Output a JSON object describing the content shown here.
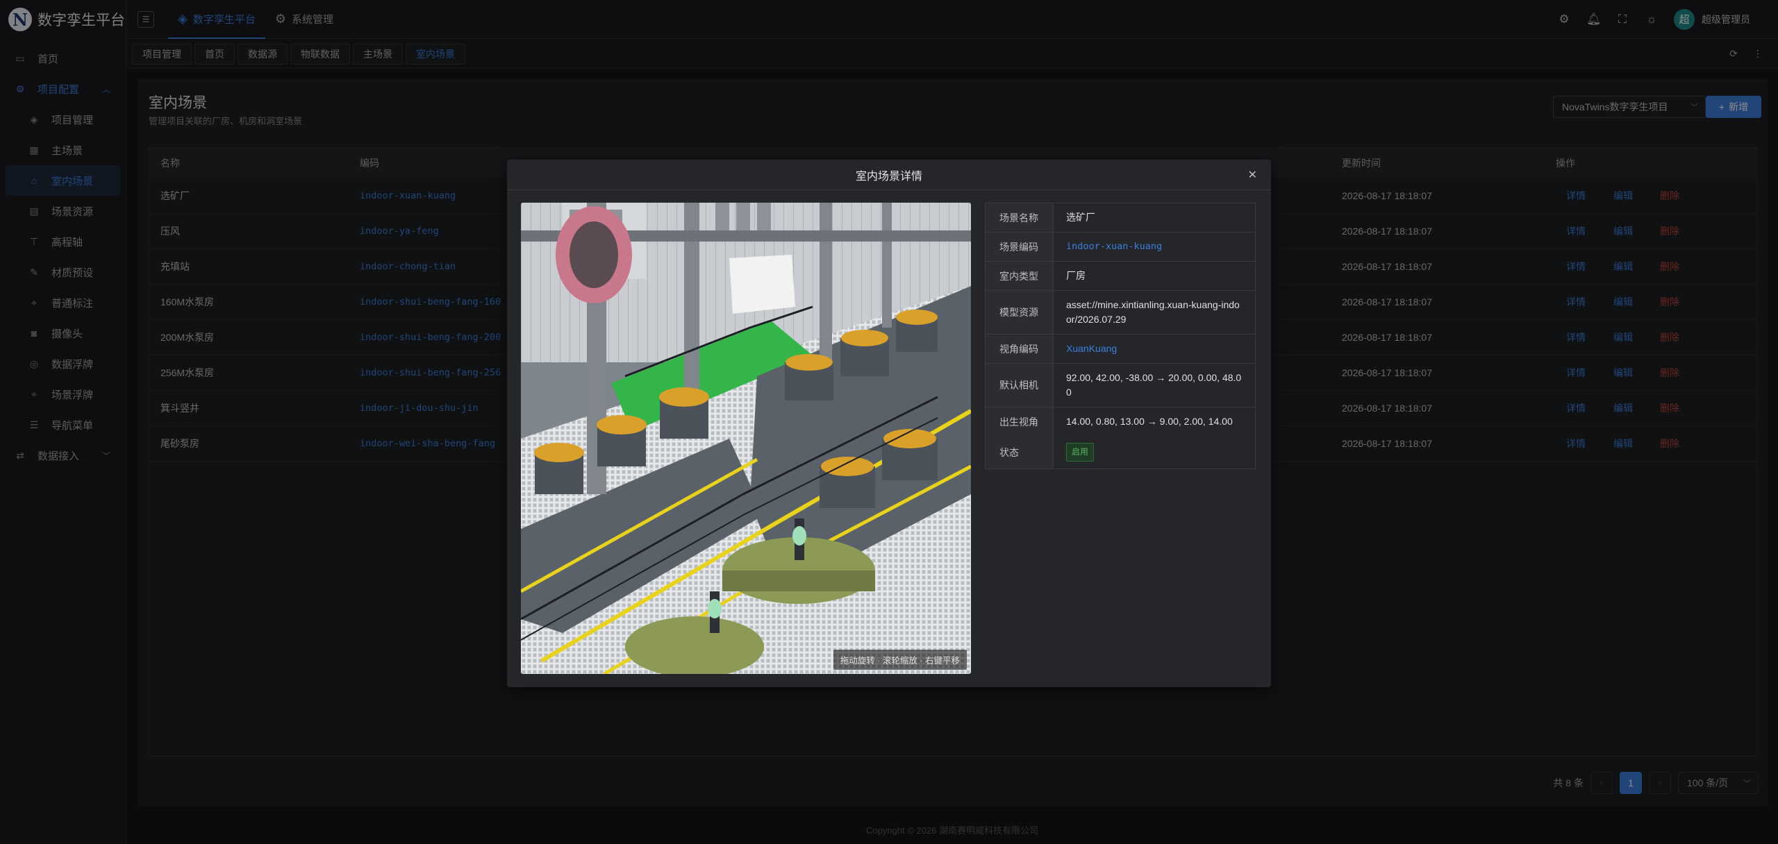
{
  "app": {
    "logo_letter": "N",
    "title": "数字孪生平台"
  },
  "header": {
    "nav": [
      {
        "label": "数字孪生平台",
        "icon": "layers-icon",
        "active": true
      },
      {
        "label": "系统管理",
        "icon": "gear-icon",
        "active": false
      }
    ],
    "avatar_text": "超",
    "user_name": "超级管理员"
  },
  "sidebar": {
    "home": "首页",
    "group_label": "项目配置",
    "items": [
      {
        "label": "项目管理",
        "icon": "layers-icon"
      },
      {
        "label": "主场景",
        "icon": "grid-icon"
      },
      {
        "label": "室内场景",
        "icon": "home-icon",
        "active": true
      },
      {
        "label": "场景资源",
        "icon": "database-icon"
      },
      {
        "label": "高程轴",
        "icon": "axis-icon"
      },
      {
        "label": "材质预设",
        "icon": "brush-icon"
      },
      {
        "label": "普通标注",
        "icon": "pin-icon"
      },
      {
        "label": "摄像头",
        "icon": "camera-icon"
      },
      {
        "label": "数据浮牌",
        "icon": "tag-icon"
      },
      {
        "label": "场景浮牌",
        "icon": "pin-icon"
      },
      {
        "label": "导航菜单",
        "icon": "menu-icon"
      }
    ],
    "data_access": "数据接入"
  },
  "tabs": [
    "项目管理",
    "首页",
    "数据源",
    "物联数据",
    "主场景",
    "室内场景"
  ],
  "page": {
    "title": "室内场景",
    "subtitle": "管理项目关联的厂房、机房和洞室场景",
    "project_select": "NovaTwins数字孪生项目",
    "add_label": "新增"
  },
  "table": {
    "headers": {
      "name": "名称",
      "code": "编码",
      "updated": "更新时间",
      "actions": "操作"
    },
    "actions": {
      "detail": "详情",
      "edit": "编辑",
      "delete": "删除"
    },
    "rows": [
      {
        "name": "选矿厂",
        "code": "indoor-xuan-kuang",
        "updated": "2026-08-17 18:18:07"
      },
      {
        "name": "压风",
        "code": "indoor-ya-feng",
        "updated": "2026-08-17 18:18:07"
      },
      {
        "name": "充填站",
        "code": "indoor-chong-tian",
        "updated": "2026-08-17 18:18:07"
      },
      {
        "name": "160M水泵房",
        "code": "indoor-shui-beng-fang-160",
        "updated": "2026-08-17 18:18:07"
      },
      {
        "name": "200M水泵房",
        "code": "indoor-shui-beng-fang-200",
        "updated": "2026-08-17 18:18:07"
      },
      {
        "name": "256M水泵房",
        "code": "indoor-shui-beng-fang-256",
        "updated": "2026-08-17 18:18:07"
      },
      {
        "name": "箕斗竖井",
        "code": "indoor-ji-dou-shu-jin",
        "updated": "2026-08-17 18:18:07"
      },
      {
        "name": "尾砂泵房",
        "code": "indoor-wei-sha-beng-fang",
        "updated": "2026-08-17 18:18:07"
      }
    ]
  },
  "pagination": {
    "total": "共 8 条",
    "current": "1",
    "page_size": "100 条/页"
  },
  "footer": "Copyright © 2026 湖南赛明威科技有限公司",
  "modal": {
    "title": "室内场景详情",
    "viewer_hint": "拖动旋转 · 滚轮缩放 · 右键平移",
    "fields": [
      {
        "label": "场景名称",
        "value": "选矿厂",
        "style": ""
      },
      {
        "label": "场景编码",
        "value": "indoor-xuan-kuang",
        "style": "link mono"
      },
      {
        "label": "室内类型",
        "value": "厂房",
        "style": ""
      },
      {
        "label": "模型资源",
        "value": "asset://mine.xintianling.xuan-kuang-indoor/2026.07.29",
        "style": ""
      },
      {
        "label": "视角编码",
        "value": "XuanKuang",
        "style": "link"
      },
      {
        "label": "默认相机",
        "value": "92.00, 42.00, -38.00 → 20.00, 0.00, 48.00",
        "style": ""
      },
      {
        "label": "出生视角",
        "value": "14.00, 0.80, 13.00 → 9.00, 2.00, 14.00",
        "style": ""
      }
    ],
    "status_label": "状态",
    "status_value": "启用"
  },
  "colors": {
    "accent": "#3c7fdc",
    "danger": "#c0443a",
    "success": "#58b26a"
  }
}
